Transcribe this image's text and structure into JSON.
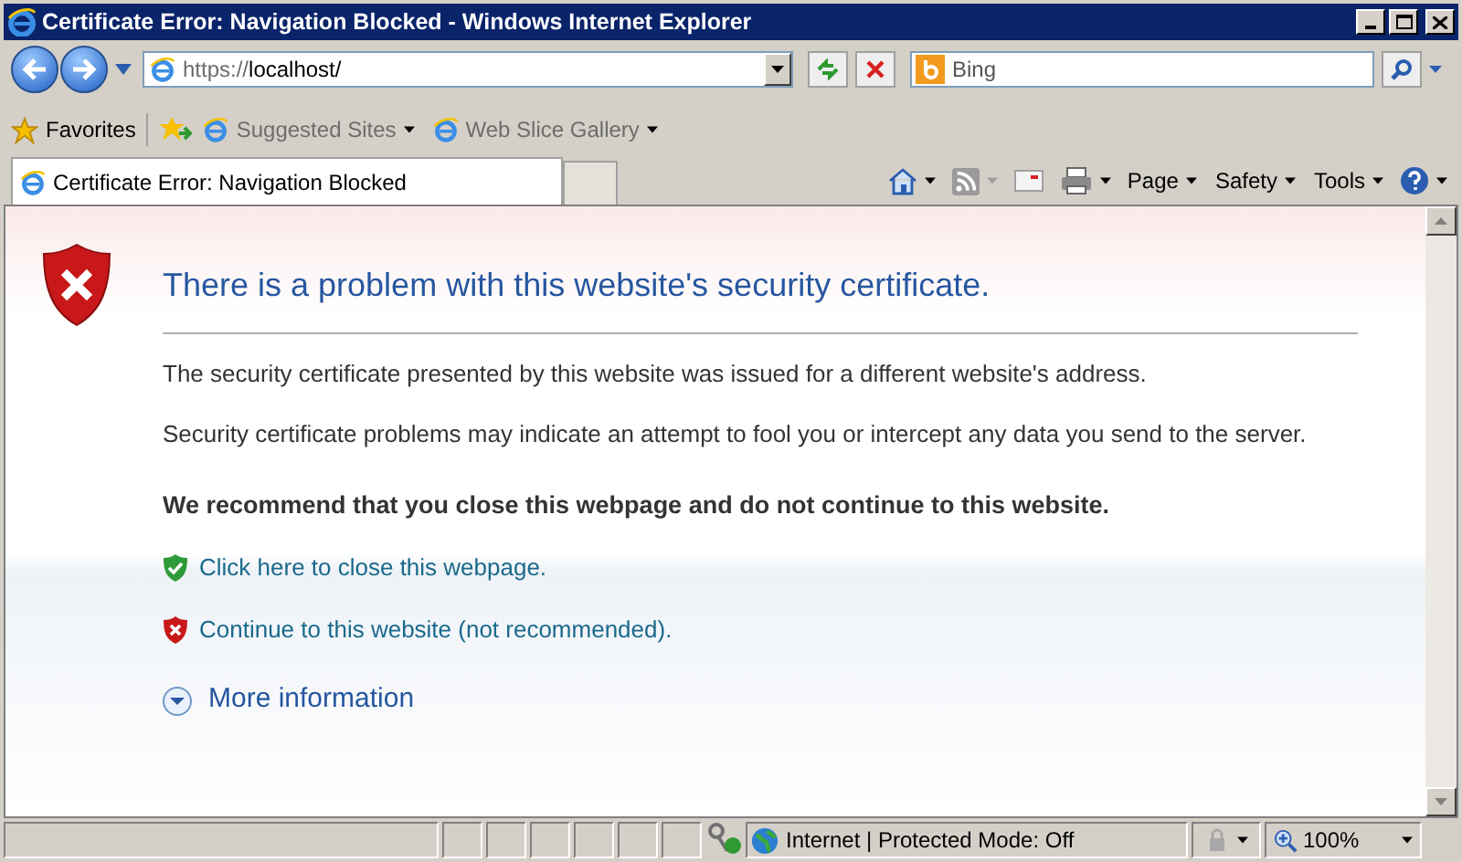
{
  "window": {
    "title": "Certificate Error: Navigation Blocked - Windows Internet Explorer"
  },
  "address": {
    "scheme": "https://",
    "host": "localhost/"
  },
  "search": {
    "placeholder": "Bing"
  },
  "favorites_bar": {
    "label": "Favorites",
    "links": [
      "Suggested Sites",
      "Web Slice Gallery"
    ]
  },
  "tabs": [
    {
      "label": "Certificate Error: Navigation Blocked",
      "selected": true
    }
  ],
  "command_bar": [
    "Page",
    "Safety",
    "Tools"
  ],
  "content": {
    "heading": "There is a problem with this website's security certificate.",
    "paragraphs": [
      "The security certificate presented by this website was issued for a different website's address.",
      "Security certificate problems may indicate an attempt to fool you or intercept any data you send to the server."
    ],
    "recommendation": "We recommend that you close this webpage and do not continue to this website.",
    "links": [
      {
        "kind": "safe",
        "text": "Click here to close this webpage."
      },
      {
        "kind": "unsafe",
        "text": "Continue to this website (not recommended)."
      }
    ],
    "more_info": "More information"
  },
  "status_bar": {
    "zone": "Internet | Protected Mode: Off",
    "zoom": "100%"
  }
}
